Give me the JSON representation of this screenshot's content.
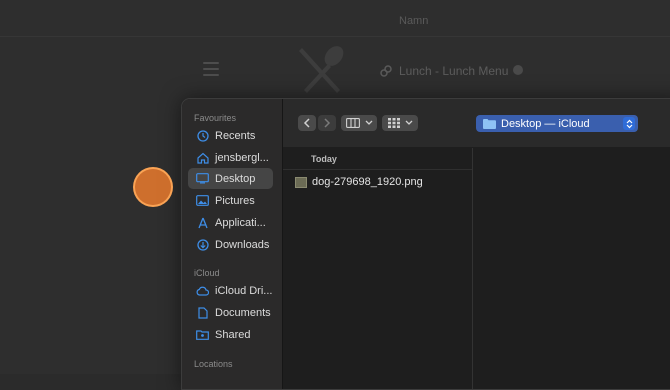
{
  "background": {
    "header_label": "Namn",
    "page_title": "Lunch - Lunch Menu"
  },
  "sidebar": {
    "favourites_label": "Favourites",
    "favourites": [
      {
        "label": "Recents",
        "icon": "clock-icon"
      },
      {
        "label": "jensbergl...",
        "icon": "home-icon"
      },
      {
        "label": "Desktop",
        "icon": "desktop-icon",
        "selected": true
      },
      {
        "label": "Pictures",
        "icon": "pictures-icon"
      },
      {
        "label": "Applicati...",
        "icon": "applications-icon"
      },
      {
        "label": "Downloads",
        "icon": "downloads-icon"
      }
    ],
    "icloud_label": "iCloud",
    "icloud": [
      {
        "label": "iCloud Dri...",
        "icon": "cloud-icon"
      },
      {
        "label": "Documents",
        "icon": "document-icon"
      },
      {
        "label": "Shared",
        "icon": "shared-folder-icon"
      }
    ],
    "locations_label": "Locations"
  },
  "toolbar": {
    "location": "Desktop — iCloud"
  },
  "column": {
    "header": "Today",
    "files": [
      {
        "name": "dog-279698_1920.png",
        "icon": "image-file-icon"
      }
    ]
  },
  "colors": {
    "accent": "#2f6cd8",
    "selection_bg": "#454545",
    "click_indicator": "#ea7a2d",
    "icon_blue": "#3e8ee8"
  }
}
